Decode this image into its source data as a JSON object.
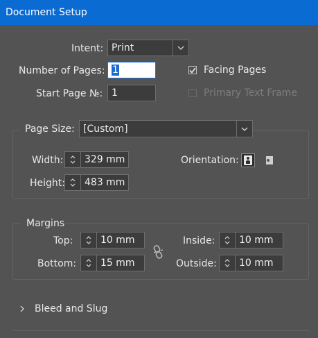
{
  "window": {
    "title": "Document Setup"
  },
  "intent": {
    "label": "Intent:",
    "value": "Print"
  },
  "pages": {
    "number_label": "Number of Pages:",
    "number_value": "1",
    "start_label": "Start Page №:",
    "start_value": "1"
  },
  "options": {
    "facing_pages": {
      "label": "Facing Pages",
      "checked": true
    },
    "primary_text_frame": {
      "label": "Primary Text Frame",
      "checked": false,
      "disabled": true
    }
  },
  "page_size": {
    "label": "Page Size:",
    "value": "[Custom]",
    "width_label": "Width:",
    "width_value": "329 mm",
    "height_label": "Height:",
    "height_value": "483 mm",
    "orientation_label": "Orientation:",
    "orientation_selected": "portrait"
  },
  "margins": {
    "title": "Margins",
    "top_label": "Top:",
    "top_value": "10 mm",
    "bottom_label": "Bottom:",
    "bottom_value": "15 mm",
    "inside_label": "Inside:",
    "inside_value": "10 mm",
    "outside_label": "Outside:",
    "outside_value": "10 mm",
    "link_icon": "broken-chain-icon"
  },
  "bleed": {
    "label": "Bleed and Slug",
    "expanded": false
  },
  "colors": {
    "titlebar": "#0a6bd3",
    "panel": "#535353",
    "field_bg": "#3c3c3c",
    "focus": "#1473e6"
  }
}
